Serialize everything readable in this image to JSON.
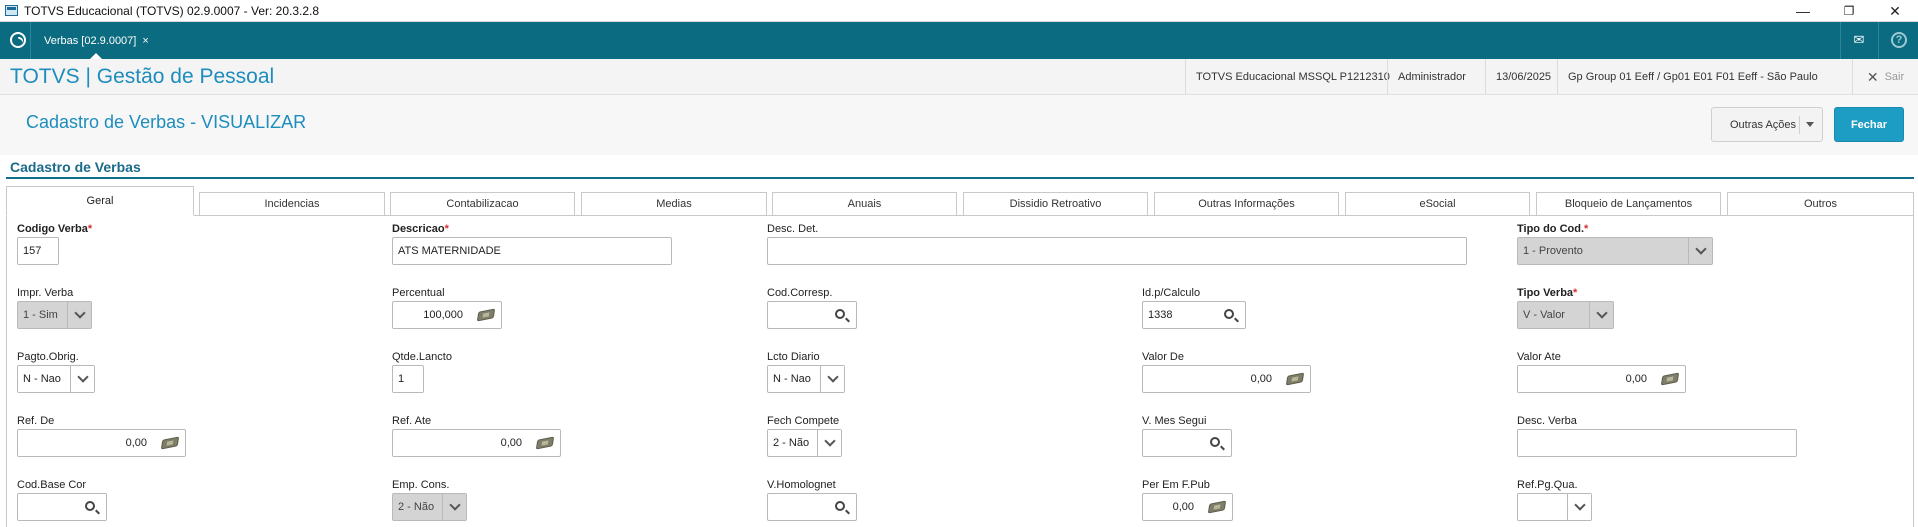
{
  "window": {
    "title": "TOTVS Educacional (TOTVS) 02.9.0007 - Ver: 20.3.2.8",
    "minimize": "—",
    "maximize": "❐",
    "close": "✕"
  },
  "tabbar": {
    "tab_label": "Verbas [02.9.0007]",
    "tab_close": "×",
    "mail_icon": "✉",
    "help_icon": "?"
  },
  "header": {
    "brand": "TOTVS | Gestão de Pessoal",
    "environment": "TOTVS Educacional MSSQL P1212310",
    "user": "Administrador",
    "date": "13/06/2025",
    "company": "Gp Group 01 Eeff / Gp01 E01 F01 Eeff - São Paulo",
    "logout": "Sair"
  },
  "page": {
    "title": "Cadastro de Verbas - VISUALIZAR",
    "actions_label": "Outras Ações",
    "close_label": "Fechar",
    "section": "Cadastro de Verbas"
  },
  "tabs": [
    "Geral",
    "Incidencias",
    "Contabilizacao",
    "Medias",
    "Anuais",
    "Dissidio Retroativo",
    "Outras Informações",
    "eSocial",
    "Bloqueio de Lançamentos",
    "Outros"
  ],
  "fields": {
    "codigo_verba": {
      "label": "Codigo Verba",
      "value": "157"
    },
    "descricao": {
      "label": "Descricao",
      "value": "ATS MATERNIDADE"
    },
    "desc_det": {
      "label": "Desc. Det.",
      "value": ""
    },
    "tipo_cod": {
      "label": "Tipo do Cod.",
      "value": "1 - Provento"
    },
    "impr_verba": {
      "label": "Impr. Verba",
      "value": "1 - Sim"
    },
    "percentual": {
      "label": "Percentual",
      "value": "100,000"
    },
    "cod_corresp": {
      "label": "Cod.Corresp.",
      "value": ""
    },
    "id_calculo": {
      "label": "Id.p/Calculo",
      "value": "1338"
    },
    "tipo_verba": {
      "label": "Tipo Verba",
      "value": "V - Valor"
    },
    "pagto_obrig": {
      "label": "Pagto.Obrig.",
      "value": "N - Nao"
    },
    "qtde_lancto": {
      "label": "Qtde.Lancto",
      "value": "1"
    },
    "lcto_diario": {
      "label": "Lcto Diario",
      "value": "N - Nao"
    },
    "valor_de": {
      "label": "Valor De",
      "value": "0,00"
    },
    "valor_ate": {
      "label": "Valor Ate",
      "value": "0,00"
    },
    "ref_de": {
      "label": "Ref. De",
      "value": "0,00"
    },
    "ref_ate": {
      "label": "Ref. Ate",
      "value": "0,00"
    },
    "fech_compete": {
      "label": "Fech Compete",
      "value": "2 - Não"
    },
    "v_mes_segui": {
      "label": "V. Mes Segui",
      "value": ""
    },
    "desc_verba": {
      "label": "Desc. Verba",
      "value": ""
    },
    "cod_base_cor": {
      "label": "Cod.Base Cor",
      "value": ""
    },
    "emp_cons": {
      "label": "Emp. Cons.",
      "value": "2 - Não"
    },
    "v_homolognet": {
      "label": "V.Homolognet",
      "value": ""
    },
    "per_em_f_pub": {
      "label": "Per Em F.Pub",
      "value": "0,00"
    },
    "ref_pg_qua": {
      "label": "Ref.Pg.Qua.",
      "value": ""
    }
  },
  "required_mark": "*"
}
